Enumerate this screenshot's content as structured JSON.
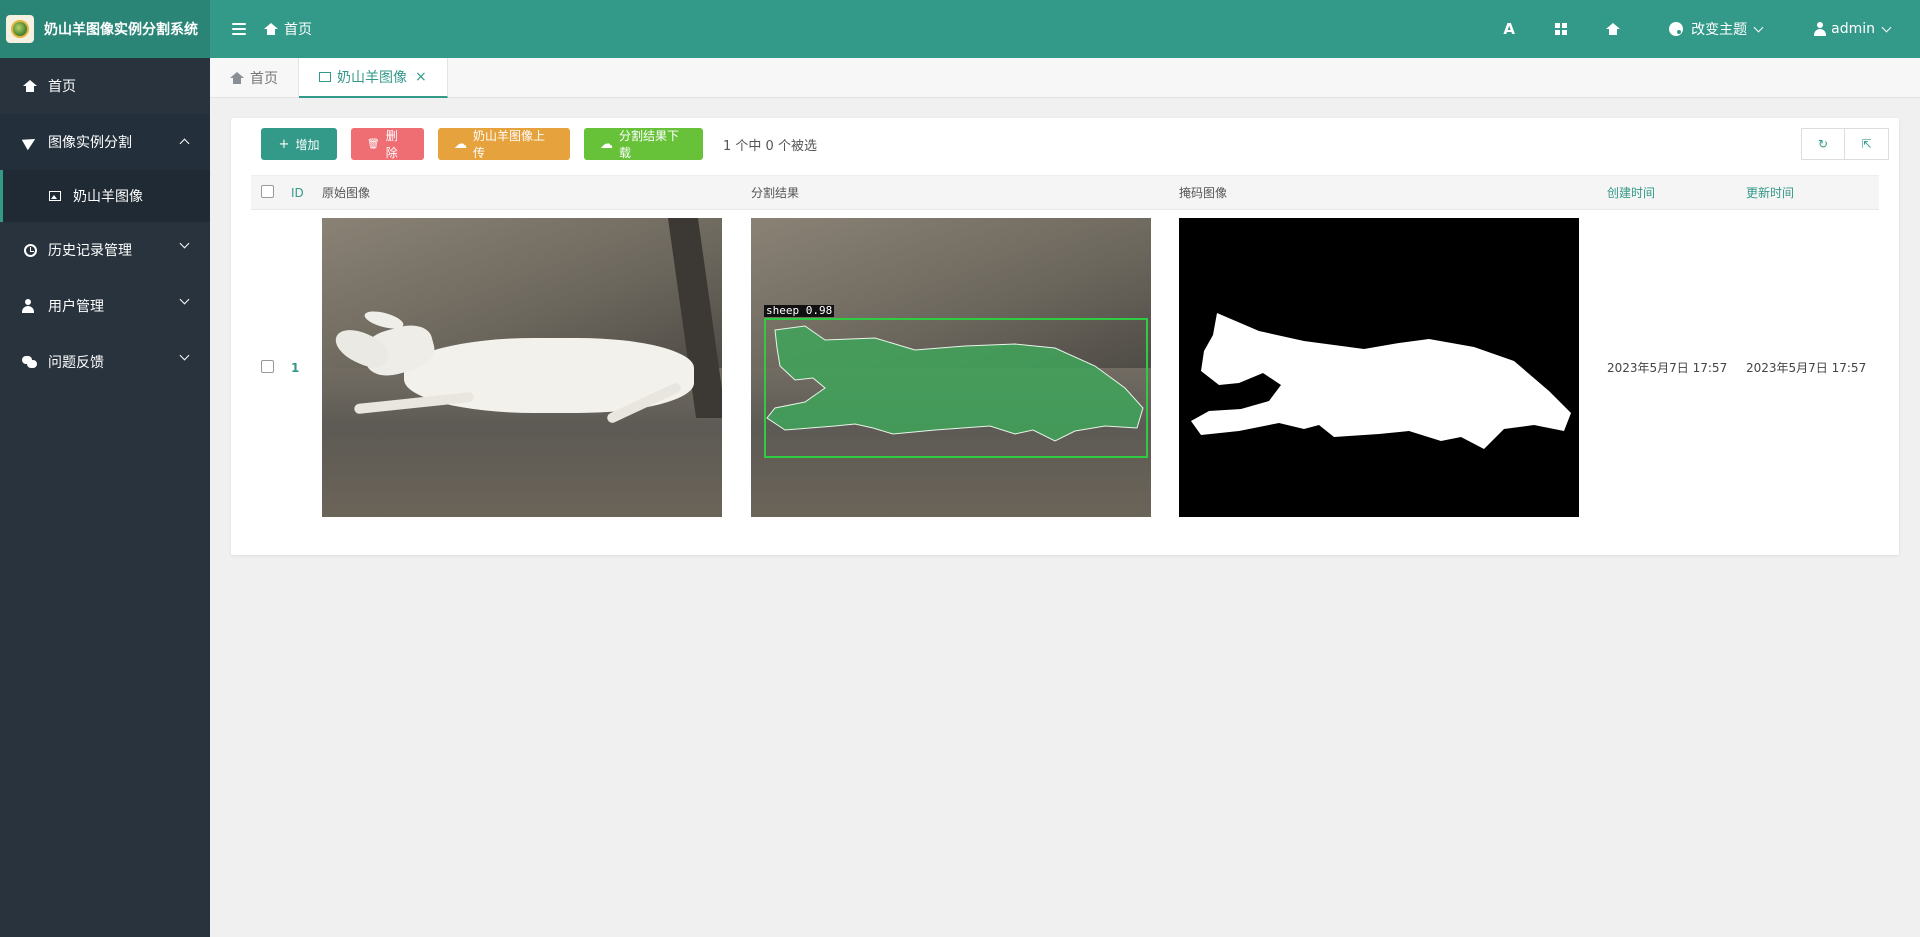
{
  "app": {
    "title": "奶山羊图像实例分割系统",
    "breadcrumb": "首页",
    "theme_label": "改变主题",
    "user_label": "admin",
    "accent_color": "#339989"
  },
  "header_tools": {
    "font_icon_glyph": "A",
    "icons": [
      "font-size-icon",
      "fullscreen-icon",
      "home-icon",
      "palette-icon",
      "user-icon"
    ]
  },
  "sidebar": {
    "items": [
      {
        "label": "首页",
        "icon": "home-icon"
      },
      {
        "label": "图像实例分割",
        "icon": "send-icon",
        "expanded": true,
        "children": [
          {
            "label": "奶山羊图像",
            "icon": "image-icon",
            "active": true
          }
        ]
      },
      {
        "label": "历史记录管理",
        "icon": "history-icon"
      },
      {
        "label": "用户管理",
        "icon": "user-cog-icon"
      },
      {
        "label": "问题反馈",
        "icon": "comments-icon"
      }
    ]
  },
  "tabs": [
    {
      "label": "首页",
      "icon": "home-icon"
    },
    {
      "label": "奶山羊图像",
      "icon": "image-icon",
      "active": true,
      "close": "×"
    }
  ],
  "toolbar": {
    "add_label": "增加",
    "delete_label": "删除",
    "upload_label": "奶山羊图像上传",
    "download_label": "分割结果下载",
    "selection_info": "1 个中 0 个被选",
    "add_glyph": "+",
    "delete_glyph": "🗑",
    "refresh_glyph": "↻",
    "export_glyph": "⇱"
  },
  "table": {
    "columns": [
      "ID",
      "原始图像",
      "分割结果",
      "掩码图像",
      "创建时间",
      "更新时间"
    ],
    "rows": [
      {
        "id": "1",
        "detection_label": "sheep 0.98",
        "created": "2023年5月7日 17:57",
        "updated": "2023年5月7日 17:57"
      }
    ]
  }
}
